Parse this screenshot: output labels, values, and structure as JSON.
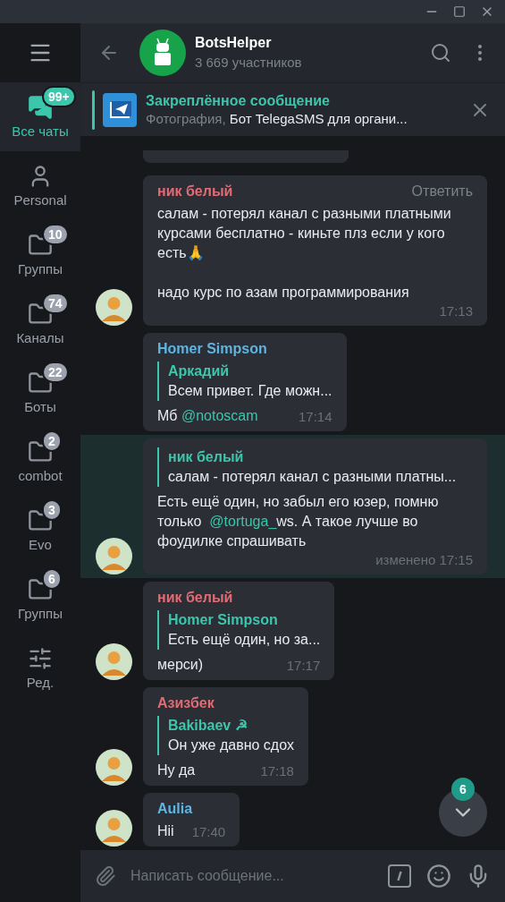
{
  "chat": {
    "title": "BotsHelper",
    "subtitle": "3 669 участников"
  },
  "pinned": {
    "label": "Закреплённое сообщение",
    "kind_text": "Фотография,",
    "text": "Бот TelegaSMS для органи..."
  },
  "sidebar": {
    "items": [
      {
        "label": "Все чаты",
        "kind": "chats",
        "badge": "99+",
        "selected": true
      },
      {
        "label": "Personal",
        "kind": "person",
        "selected": false
      },
      {
        "label": "Группы",
        "kind": "folder",
        "badge": "10",
        "selected": false
      },
      {
        "label": "Каналы",
        "kind": "folder",
        "badge": "74",
        "selected": false
      },
      {
        "label": "Боты",
        "kind": "folder",
        "badge": "22",
        "selected": false
      },
      {
        "label": "combot",
        "kind": "folder",
        "badge": "2",
        "selected": false
      },
      {
        "label": "Evo",
        "kind": "folder",
        "badge": "3",
        "selected": false
      },
      {
        "label": "Группы",
        "kind": "folder",
        "badge": "6",
        "selected": false
      },
      {
        "label": "Ред.",
        "kind": "edit",
        "selected": false
      }
    ]
  },
  "messages": [
    {
      "author": "ник белый",
      "color": "#e06c75",
      "action": "Ответить",
      "text": [
        {
          "text": "салам - потерял канал с разными платными курсами бесплатно - киньте плз если у кого есть🙏\n\nнадо курс по азам программирования",
          "link": false
        }
      ],
      "time": "17:13",
      "avatar": true,
      "highlighted": false
    },
    {
      "author": "Homer Simpson",
      "color": "#5fb4e0",
      "reply": {
        "author": "Аркадий",
        "text": "Всем привет. Где можн..."
      },
      "text": [
        {
          "text": "Мб ",
          "link": false
        },
        {
          "text": "@notoscam",
          "link": true
        }
      ],
      "time": "17:14",
      "avatar": false,
      "highlighted": false
    },
    {
      "reply": {
        "author": "ник белый",
        "text": "салам - потерял канал с разными платны..."
      },
      "text": [
        {
          "text": "Есть ещё один, но забыл его юзер, помню только  ",
          "link": false
        },
        {
          "text": "@tortuga_",
          "link": true
        },
        {
          "text": "ws. А такое лучше во фоудилке спрашивать",
          "link": false
        }
      ],
      "time": "изменено 17:15",
      "avatar": true,
      "highlighted": true
    },
    {
      "author": "ник белый",
      "color": "#e06c75",
      "reply": {
        "author": "Homer Simpson",
        "text": "Есть ещё один, но за..."
      },
      "text": [
        {
          "text": "мерси)",
          "link": false
        }
      ],
      "time": "17:17",
      "avatar": true,
      "highlighted": false
    },
    {
      "author": "Азизбек",
      "color": "#e06c75",
      "reply": {
        "author": "Bakibaev ☭",
        "text": "Он уже давно сдох"
      },
      "text": [
        {
          "text": "Ну да",
          "link": false
        }
      ],
      "time": "17:18",
      "avatar": true,
      "highlighted": false
    },
    {
      "author": "Aulia",
      "color": "#5fb4e0",
      "text": [
        {
          "text": "Hii",
          "link": false
        }
      ],
      "time": "17:40",
      "avatar": true,
      "highlighted": false
    }
  ],
  "scroll_badge": "6",
  "composer": {
    "placeholder": "Написать сообщение..."
  }
}
